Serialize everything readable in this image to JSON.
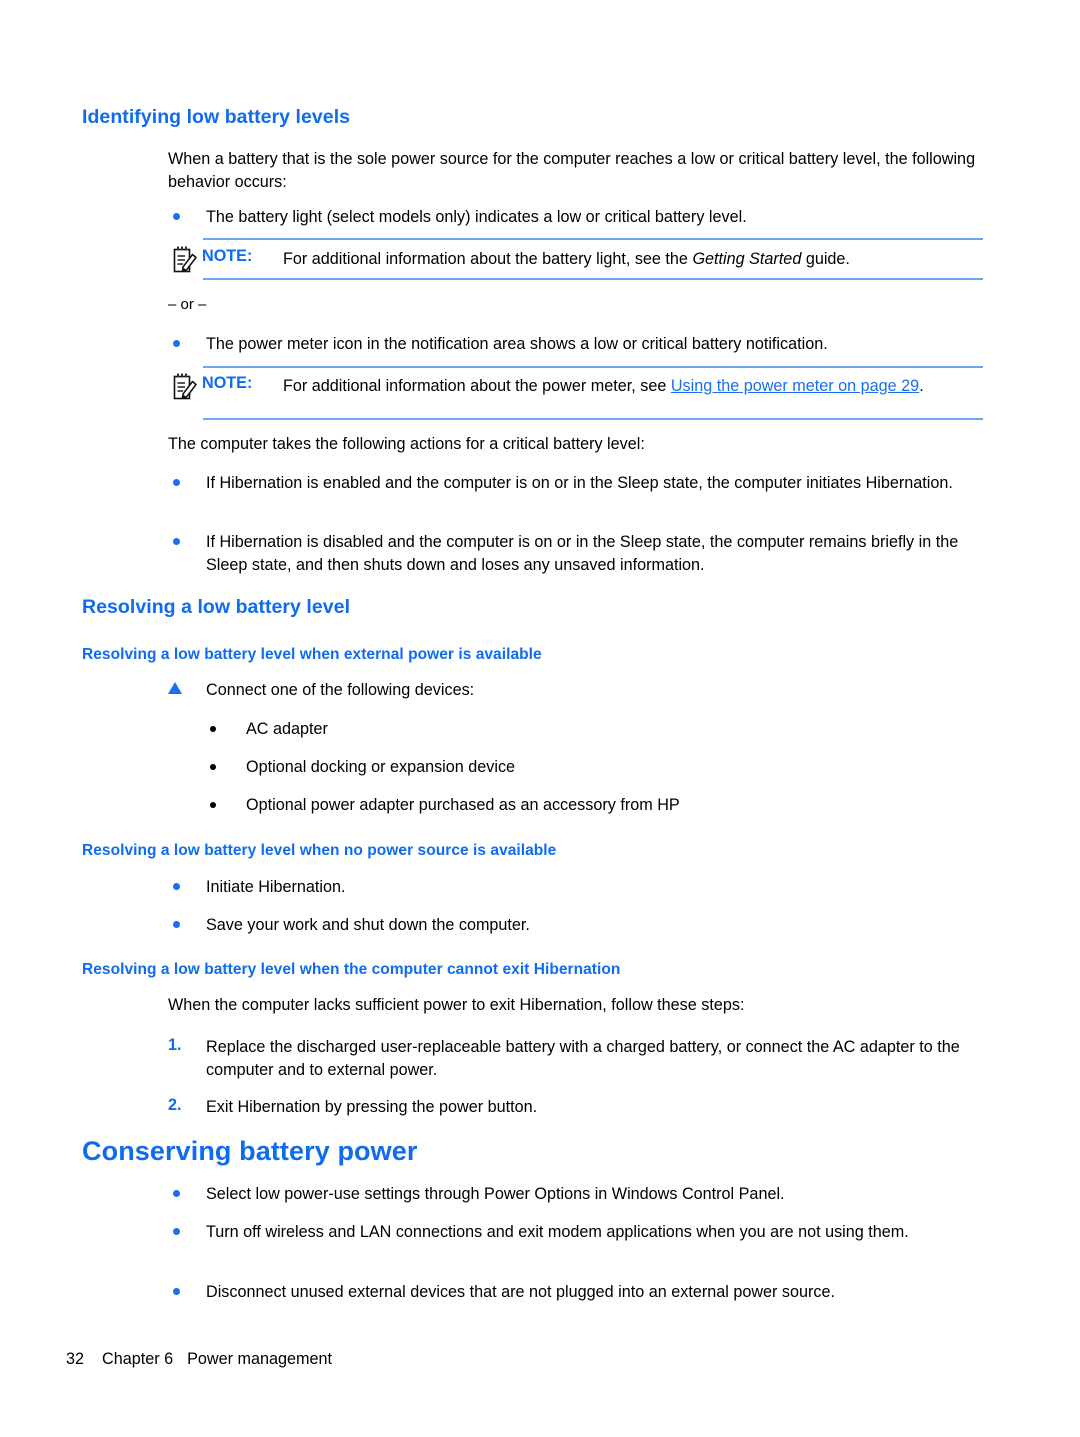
{
  "document": {
    "sections": [
      {
        "id": "identifying-low-battery-levels",
        "heading": "Identifying low battery levels",
        "intro": "When a battery that is the sole power source for the computer reaches a low or critical battery level, the following behavior occurs:",
        "bullet_1": "The battery light (select models only) indicates a low or critical battery level.",
        "note_1": {
          "label": "NOTE:",
          "text_before": "For additional information about the battery light, see the ",
          "italic": "Getting Started",
          "text_after": " guide.",
          "icon": "note-pad-pencil-icon"
        },
        "or_separator": "– or –",
        "bullet_2": "The power meter icon in the notification area shows a low or critical battery notification.",
        "note_2": {
          "label": "NOTE:",
          "text_before": "For additional information about the power meter, see ",
          "link": "Using the power meter on page 29",
          "text_after": ".",
          "icon": "note-pad-pencil-icon"
        },
        "para_2": "The computer takes the following actions for a critical battery level:",
        "bullet_3": "If Hibernation is enabled and the computer is on or in the Sleep state, the computer initiates Hibernation.",
        "bullet_4": "If Hibernation is disabled and the computer is on or in the Sleep state, the computer remains briefly in the Sleep state, and then shuts down and loses any unsaved information."
      },
      {
        "id": "resolving-a-low-battery-level",
        "heading": "Resolving a low battery level",
        "sub_1": {
          "heading": "Resolving a low battery level when external power is available",
          "step": "Connect one of the following devices:",
          "items": [
            "AC adapter",
            "Optional docking or expansion device",
            "Optional power adapter purchased as an accessory from HP"
          ]
        },
        "sub_2": {
          "heading": "Resolving a low battery level when no power source is available",
          "items": [
            "Initiate Hibernation.",
            "Save your work and shut down the computer."
          ]
        },
        "sub_3": {
          "heading": "Resolving a low battery level when the computer cannot exit Hibernation",
          "intro": "When the computer lacks sufficient power to exit Hibernation, follow these steps:",
          "steps": [
            {
              "number": "1.",
              "text": "Replace the discharged user-replaceable battery with a charged battery, or connect the AC adapter to the computer and to external power."
            },
            {
              "number": "2.",
              "text": "Exit Hibernation by pressing the power button."
            }
          ]
        }
      },
      {
        "id": "conserving-battery-power",
        "heading": "Conserving battery power",
        "items": [
          "Select low power-use settings through Power Options in Windows Control Panel.",
          "Turn off wireless and LAN connections and exit modem applications when you are not using them.",
          "Disconnect unused external devices that are not plugged into an external power source."
        ]
      }
    ],
    "footer": {
      "page_number": "32",
      "chapter": "Chapter 6",
      "title": "Power management"
    },
    "colors": {
      "heading_blue": "#0f6cf0",
      "link_blue": "#1a6ef0",
      "rule_blue": "#6aa5f5",
      "body_black": "#000000"
    }
  }
}
